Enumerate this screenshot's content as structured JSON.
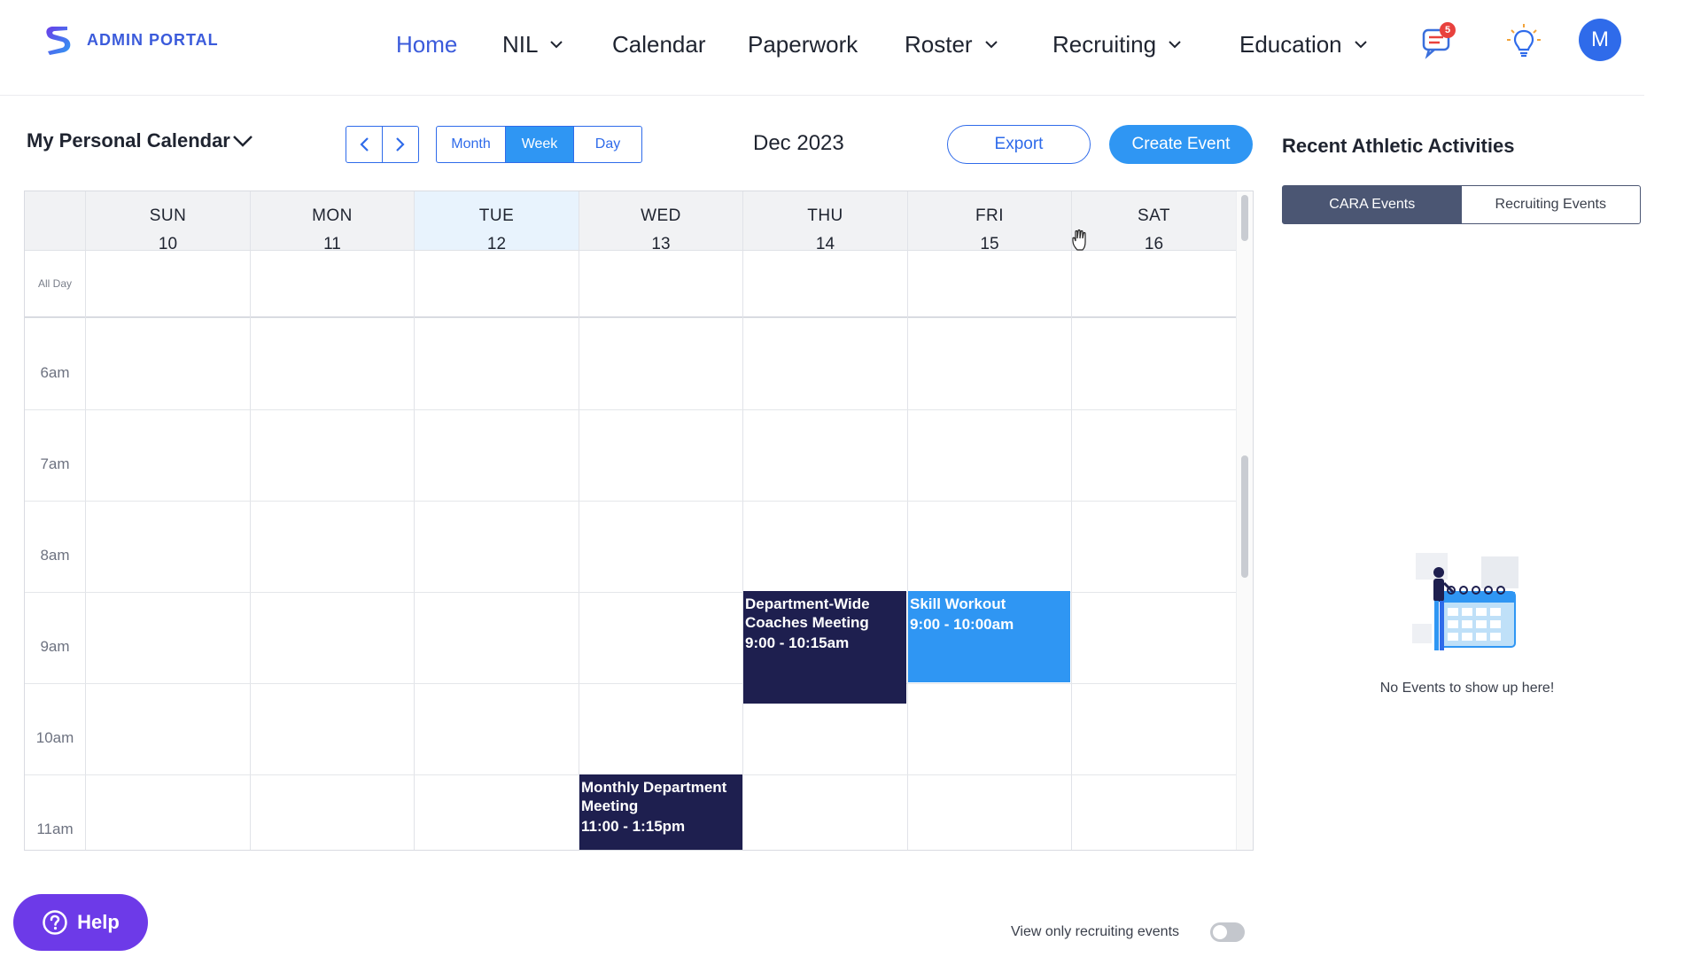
{
  "brand": {
    "name": "ADMIN PORTAL"
  },
  "nav": {
    "items": [
      {
        "label": "Home",
        "active": true,
        "dropdown": false
      },
      {
        "label": "NIL",
        "active": false,
        "dropdown": true
      },
      {
        "label": "Calendar",
        "active": false,
        "dropdown": false
      },
      {
        "label": "Paperwork",
        "active": false,
        "dropdown": false
      },
      {
        "label": "Roster",
        "active": false,
        "dropdown": true
      },
      {
        "label": "Recruiting",
        "active": false,
        "dropdown": true
      },
      {
        "label": "Education",
        "active": false,
        "dropdown": true
      }
    ],
    "notification_count": "5",
    "avatar_initial": "M",
    "icons": [
      "chat-icon",
      "lightbulb-icon"
    ]
  },
  "toolbar": {
    "calendar_select": "My Personal Calendar",
    "views": [
      "Month",
      "Week",
      "Day"
    ],
    "active_view": "Week",
    "current_period": "Dec 2023",
    "export_label": "Export",
    "create_label": "Create Event"
  },
  "calendar": {
    "days": [
      {
        "name": "SUN",
        "date": "10"
      },
      {
        "name": "MON",
        "date": "11"
      },
      {
        "name": "TUE",
        "date": "12",
        "today": true
      },
      {
        "name": "WED",
        "date": "13"
      },
      {
        "name": "THU",
        "date": "14"
      },
      {
        "name": "FRI",
        "date": "15"
      },
      {
        "name": "SAT",
        "date": "16"
      }
    ],
    "all_day_label": "All Day",
    "hours": [
      "6am",
      "7am",
      "8am",
      "9am",
      "10am",
      "11am"
    ],
    "events": [
      {
        "title": "Department-Wide Coaches Meeting",
        "time": "9:00 - 10:15am",
        "day": "THU",
        "style": "dark"
      },
      {
        "title": "Skill Workout",
        "time": "9:00 - 10:00am",
        "day": "FRI",
        "style": "blue"
      },
      {
        "title": "Monthly Department Meeting",
        "time": "11:00 - 1:15pm",
        "day": "WED",
        "style": "dark"
      }
    ]
  },
  "panel": {
    "title": "Recent Athletic Activities",
    "tabs": [
      "CARA Events",
      "Recruiting Events"
    ],
    "active_tab": "CARA Events",
    "empty_message": "No Events to show up here!"
  },
  "footer": {
    "help_label": "Help",
    "toggle_label": "View only recruiting events",
    "toggle_on": false
  },
  "colors": {
    "primary": "#2f6bea",
    "accent_blue": "#2f96f3",
    "event_dark": "#1e1f4f",
    "tab_active": "#4b5673",
    "help_purple": "#6d3ae8",
    "badge_red": "#e8413d"
  }
}
